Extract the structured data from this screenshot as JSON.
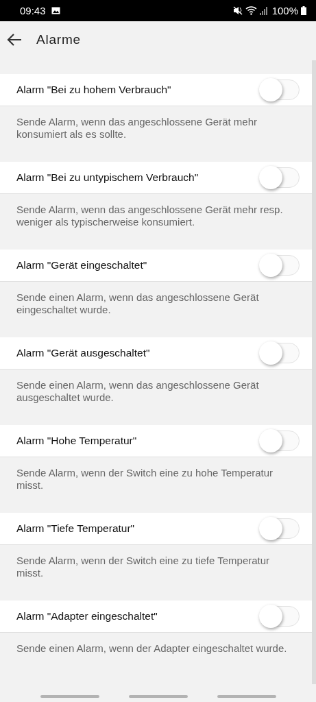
{
  "status_bar": {
    "time": "09:43",
    "battery": "100%"
  },
  "header": {
    "title": "Alarme"
  },
  "alarms": [
    {
      "title": "Alarm \"Bei zu hohem Verbrauch\"",
      "on": false,
      "description": "Sende Alarm, wenn das angeschlossene Gerät mehr konsumiert als es sollte."
    },
    {
      "title": "Alarm \"Bei zu untypischem Verbrauch\"",
      "on": false,
      "description": "Sende Alarm, wenn das angeschlossene Gerät mehr resp. weniger als typischerweise konsumiert."
    },
    {
      "title": "Alarm \"Gerät eingeschaltet\"",
      "on": false,
      "description": "Sende einen Alarm, wenn das angeschlossene Gerät eingeschaltet wurde."
    },
    {
      "title": "Alarm \"Gerät ausgeschaltet\"",
      "on": false,
      "description": "Sende einen Alarm, wenn das angeschlossene Gerät ausgeschaltet wurde."
    },
    {
      "title": "Alarm \"Hohe Temperatur\"",
      "on": false,
      "description": "Sende Alarm, wenn der Switch eine zu hohe Temperatur misst."
    },
    {
      "title": "Alarm \"Tiefe Temperatur\"",
      "on": false,
      "description": "Sende Alarm, wenn der Switch eine zu tiefe Temperatur misst."
    },
    {
      "title": "Alarm \"Adapter eingeschaltet\"",
      "on": false,
      "description": "Sende einen Alarm, wenn der Adapter eingeschaltet wurde."
    }
  ]
}
